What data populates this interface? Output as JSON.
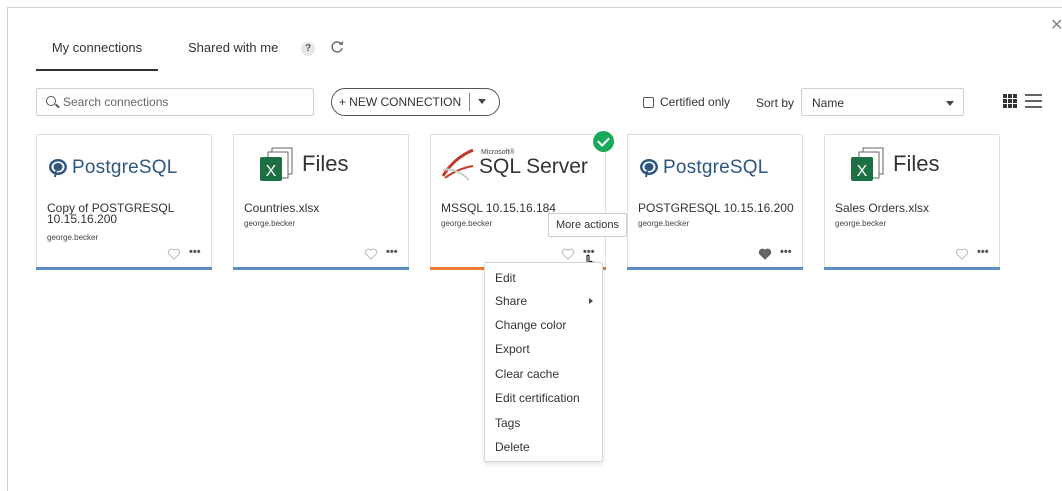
{
  "tabs": [
    {
      "label": "My connections",
      "active": true
    },
    {
      "label": "Shared with me",
      "active": false
    }
  ],
  "help_icon": "?",
  "icons": {
    "help": "question-mark-icon",
    "refresh": "refresh-icon",
    "search": "search-icon",
    "close": "close-icon",
    "grid": "grid-view-icon",
    "list": "list-view-icon",
    "heart": "heart-icon",
    "more": "more-dots-icon",
    "certified": "check-circle-icon"
  },
  "search": {
    "placeholder": "Search connections"
  },
  "new_connection": {
    "label": "+ NEW CONNECTION"
  },
  "filters": {
    "certified_label": "Certified only",
    "certified_checked": false,
    "sort_label": "Sort by",
    "sort_value": "Name"
  },
  "colors": {
    "accent_blue": "#5b8ec2",
    "accent_orange": "#f07c2d",
    "certified_green": "#19a95a",
    "postgres_blue": "#2f5680",
    "excel_green": "#1d7044"
  },
  "cards": [
    {
      "logo": "PostgreSQL",
      "title": "Copy of POSTGRESQL 10.15.16.200",
      "owner": "george.becker",
      "favorite": false,
      "certified": false
    },
    {
      "logo": "Files",
      "title": "Countries.xlsx",
      "owner": "george.becker",
      "favorite": false,
      "certified": false
    },
    {
      "logo": "SQL Server",
      "logo_small": "Microsoft®",
      "title": "MSSQL 10.15.16.184",
      "owner": "george.becker",
      "favorite": false,
      "certified": true
    },
    {
      "logo": "PostgreSQL",
      "title": "POSTGRESQL 10.15.16.200",
      "owner": "george.becker",
      "favorite": true,
      "certified": false
    },
    {
      "logo": "Files",
      "title": "Sales Orders.xlsx",
      "owner": "george.becker",
      "favorite": false,
      "certified": false
    }
  ],
  "tooltip": "More actions",
  "more_dots": "•••",
  "context_menu": [
    {
      "label": "Edit",
      "has_submenu": false
    },
    {
      "label": "Share",
      "has_submenu": true
    },
    {
      "label": "Change color",
      "has_submenu": false
    },
    {
      "label": "Export",
      "has_submenu": false
    },
    {
      "label": "Clear cache",
      "has_submenu": false
    },
    {
      "label": "Edit certification",
      "has_submenu": false
    },
    {
      "label": "Tags",
      "has_submenu": false
    },
    {
      "label": "Delete",
      "has_submenu": false
    }
  ]
}
